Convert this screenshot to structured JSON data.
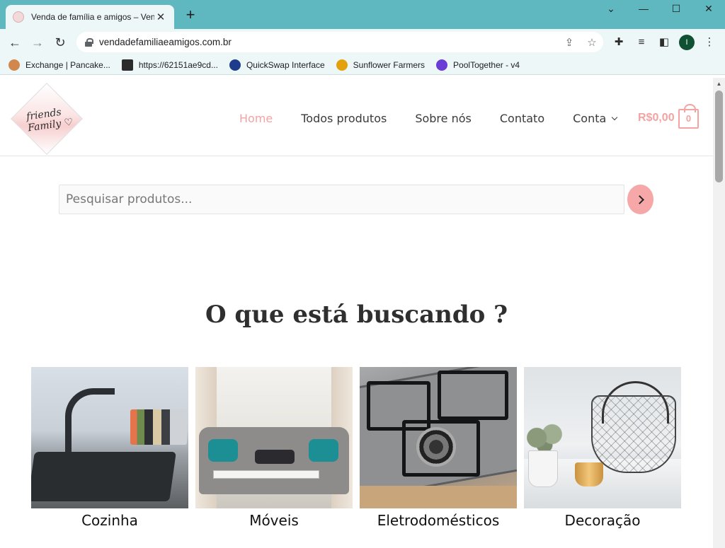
{
  "browser": {
    "tab": {
      "title": "Venda de família e amigos – Venda de família e amigos"
    },
    "new_tab_label": "+",
    "window_controls": {
      "minimize": "—",
      "maximize": "☐",
      "close": "✕",
      "tab_search": "⌄"
    },
    "address": {
      "url": "vendadefamiliaeamigos.com.br"
    },
    "profile_initial": "I",
    "bookmarks": [
      {
        "label": "Exchange | Pancake...",
        "icon": "pancake-bunny-icon",
        "color": "#d1884f"
      },
      {
        "label": "https://62151ae9cd...",
        "icon": "aptos-apt-icon",
        "color": "#2b2b2b"
      },
      {
        "label": "QuickSwap Interface",
        "icon": "quickswap-icon",
        "color": "#1f3b8c"
      },
      {
        "label": "Sunflower Farmers",
        "icon": "sunflower-icon",
        "color": "#e3a10d"
      },
      {
        "label": "PoolTogether - v4",
        "icon": "pooltogether-icon",
        "color": "#6b3cd6"
      }
    ]
  },
  "site": {
    "logo": {
      "line1": "friends",
      "line2": "Family ♡"
    },
    "nav": [
      {
        "label": "Home",
        "active": true
      },
      {
        "label": "Todos produtos",
        "active": false
      },
      {
        "label": "Sobre nós",
        "active": false
      },
      {
        "label": "Contato",
        "active": false
      },
      {
        "label": "Conta",
        "active": false,
        "dropdown": true
      }
    ],
    "cart": {
      "total": "R$0,00",
      "count": "0"
    },
    "search": {
      "placeholder": "Pesquisar produtos..."
    },
    "section_heading": "O que está buscando ?",
    "categories": [
      {
        "label": "Cozinha",
        "image": "kitchen-sink-photo"
      },
      {
        "label": "Móveis",
        "image": "sofa-living-room-photo"
      },
      {
        "label": "Eletrodomésticos",
        "image": "gas-cooktop-photo"
      },
      {
        "label": "Decoração",
        "image": "decor-basket-photo"
      }
    ],
    "colors": {
      "accent": "#f4a3a3",
      "text": "#3a3a3a",
      "chrome": "#5fb8bf"
    }
  }
}
